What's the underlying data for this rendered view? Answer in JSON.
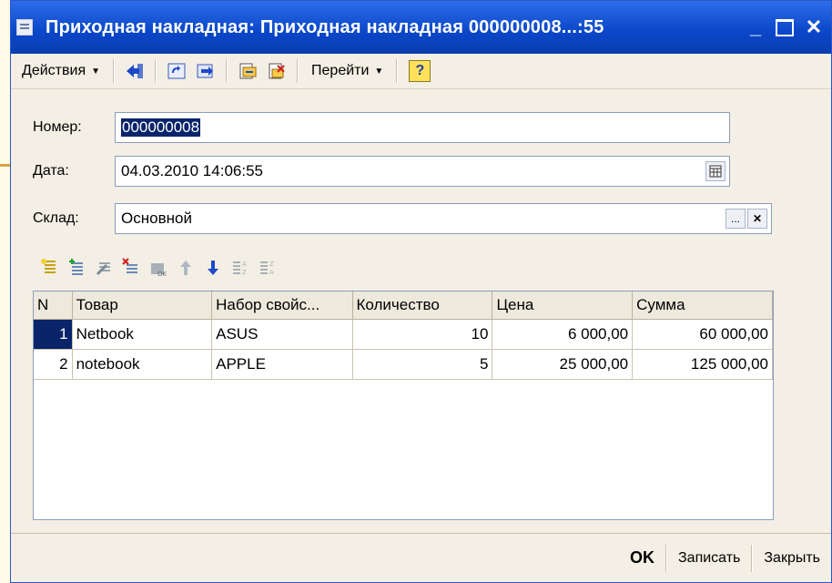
{
  "window": {
    "title": "Приходная накладная: Приходная накладная 000000008...:55",
    "minimize": "_",
    "close": "✕"
  },
  "toolbar": {
    "actions_label": "Действия",
    "goto_label": "Перейти",
    "help_label": "?"
  },
  "form": {
    "number_label": "Номер:",
    "number_value": "000000008",
    "date_label": "Дата:",
    "date_value": "04.03.2010 14:06:55",
    "warehouse_label": "Склад:",
    "warehouse_value": "Основной",
    "select_btn": "...",
    "clear_btn": "✕"
  },
  "table": {
    "columns": [
      "N",
      "Товар",
      "Набор свойс...",
      "Количество",
      "Цена",
      "Сумма"
    ],
    "rows": [
      {
        "n": "1",
        "item": "Netbook",
        "props": "ASUS",
        "qty": "10",
        "price": "6 000,00",
        "sum": "60 000,00"
      },
      {
        "n": "2",
        "item": "notebook",
        "props": "APPLE",
        "qty": "5",
        "price": "25 000,00",
        "sum": "125 000,00"
      }
    ]
  },
  "footer": {
    "ok_label": "OK",
    "save_label": "Записать",
    "close_label": "Закрыть"
  },
  "colors": {
    "titlebar": "#0a46c8",
    "selection": "#0a246a",
    "background": "#f3efe4"
  }
}
